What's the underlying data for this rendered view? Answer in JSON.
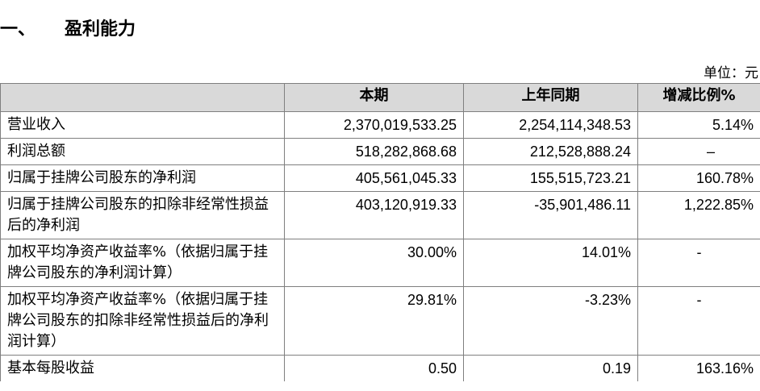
{
  "section": {
    "number": "一、",
    "title": "盈利能力"
  },
  "unit_label": "单位：元",
  "table": {
    "headers": [
      "",
      "本期",
      "上年同期",
      "增减比例%"
    ],
    "rows": [
      {
        "label": "营业收入",
        "current": "2,370,019,533.25",
        "prior": "2,254,114,348.53",
        "change": "5.14%"
      },
      {
        "label": "利润总额",
        "current": "518,282,868.68",
        "prior": "212,528,888.24",
        "change": "–"
      },
      {
        "label": "归属于挂牌公司股东的净利润",
        "current": "405,561,045.33",
        "prior": "155,515,723.21",
        "change": "160.78%"
      },
      {
        "label": "归属于挂牌公司股东的扣除非经常性损益后的净利润",
        "current": "403,120,919.33",
        "prior": "-35,901,486.11",
        "change": "1,222.85%"
      },
      {
        "label": "加权平均净资产收益率%（依据归属于挂牌公司股东的净利润计算）",
        "current": "30.00%",
        "prior": "14.01%",
        "change": "-"
      },
      {
        "label": "加权平均净资产收益率%（依据归属于挂牌公司股东的扣除非经常性损益后的净利润计算）",
        "current": "29.81%",
        "prior": "-3.23%",
        "change": "-"
      },
      {
        "label": "基本每股收益",
        "current": "0.50",
        "prior": "0.19",
        "change": "163.16%"
      }
    ]
  }
}
